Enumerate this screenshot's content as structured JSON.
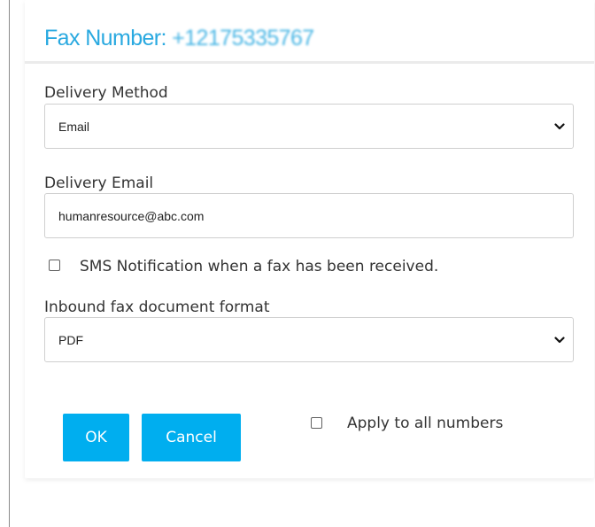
{
  "dialog": {
    "title_label": "Fax Number:",
    "title_number": "+12175335767"
  },
  "delivery_method": {
    "label": "Delivery Method",
    "selected": "Email"
  },
  "delivery_email": {
    "label": "Delivery Email",
    "value": "humanresource@abc.com"
  },
  "sms_notification": {
    "label": "SMS Notification when a fax has been received.",
    "checked": false
  },
  "document_format": {
    "label": "Inbound fax document format",
    "selected": "PDF"
  },
  "buttons": {
    "ok_label": "OK",
    "cancel_label": "Cancel"
  },
  "apply_all": {
    "label": "Apply to all numbers",
    "checked": false
  },
  "icons": {
    "dropdown": "chevron-down-icon",
    "checkbox": "checkbox-icon"
  },
  "colors": {
    "accent": "#29a9e0",
    "button": "#00aeef",
    "button_text": "#ffffff"
  }
}
